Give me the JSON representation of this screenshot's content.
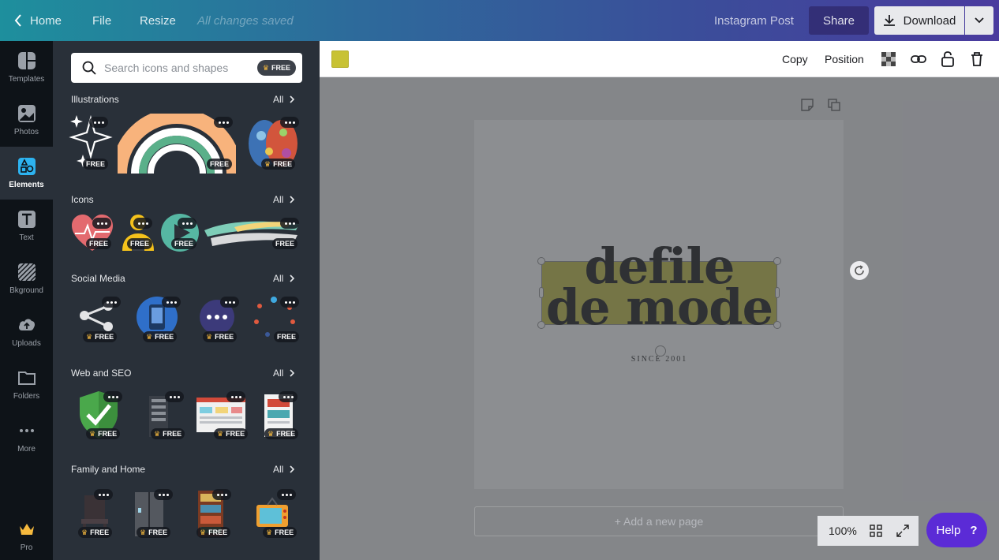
{
  "topbar": {
    "home": "Home",
    "file": "File",
    "resize": "Resize",
    "saved_status": "All changes saved",
    "doc_title": "Instagram Post",
    "share": "Share",
    "download": "Download"
  },
  "rail": {
    "items": [
      {
        "label": "Templates"
      },
      {
        "label": "Photos"
      },
      {
        "label": "Elements"
      },
      {
        "label": "Text"
      },
      {
        "label": "Bkground"
      },
      {
        "label": "Uploads"
      },
      {
        "label": "Folders"
      },
      {
        "label": "More"
      },
      {
        "label": "Pro"
      }
    ]
  },
  "panel": {
    "search_placeholder": "Search icons and shapes",
    "free_pill": "FREE",
    "all_label": "All",
    "free_badge": "FREE",
    "sections": [
      {
        "title": "Illustrations"
      },
      {
        "title": "Icons"
      },
      {
        "title": "Social Media"
      },
      {
        "title": "Web and SEO"
      },
      {
        "title": "Family and Home"
      }
    ]
  },
  "toolbar": {
    "copy": "Copy",
    "position": "Position",
    "swatch_color": "#c8c234"
  },
  "canvas": {
    "line1": "defile",
    "line2": "de mode",
    "since": "SINCE 2001",
    "add_page": "+ Add a new page",
    "zoom": "100%"
  },
  "help": {
    "label": "Help",
    "mark": "?"
  },
  "colors": {
    "accent_purple": "#5b2bd6",
    "rail_bg": "#0e1318",
    "panel_bg": "#293039",
    "highlight_yellow": "#c2be3a"
  }
}
